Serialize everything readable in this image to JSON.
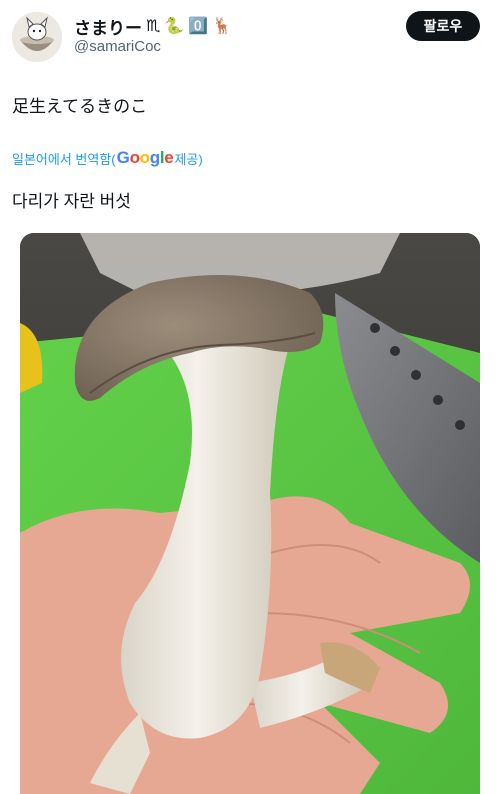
{
  "user": {
    "display_name": "さまりー",
    "emojis": [
      "♏",
      "🐍",
      "0️⃣",
      "🦌"
    ],
    "handle": "@samariCoc",
    "avatar_icon": "cat-in-bowl-avatar-icon"
  },
  "follow_label": "팔로우",
  "tweet": {
    "text": "足生えてるきのこ",
    "translate_prefix": "일본어에서 번역함(",
    "translate_brand": [
      "G",
      "o",
      "o",
      "g",
      "l",
      "e"
    ],
    "translate_suffix": " 제공)",
    "translated_text": "다리가 자란 버섯"
  },
  "media": {
    "icon": "mushroom-photo",
    "colors": {
      "board": "#5cc845",
      "cap": "#8a7a6a",
      "stem": "#f1ede4",
      "hand": "#e8aa95"
    }
  }
}
